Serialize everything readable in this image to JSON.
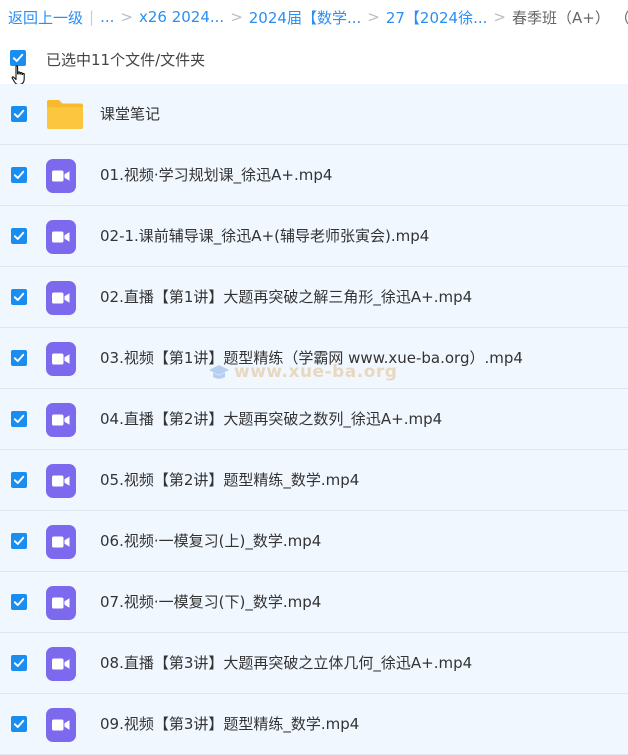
{
  "breadcrumb": {
    "back": "返回上一级",
    "divider": "|",
    "sep": ">",
    "items": [
      "...",
      "x26 2024...",
      "2024届【数学...",
      "27【2024徐..."
    ],
    "current": "春季班（A+）  （"
  },
  "selection": {
    "text": "已选中11个文件/文件夹"
  },
  "files": [
    {
      "type": "folder",
      "name": "课堂笔记"
    },
    {
      "type": "video",
      "name": "01.视频·学习规划课_徐迅A+.mp4"
    },
    {
      "type": "video",
      "name": "02-1.课前辅导课_徐迅A+(辅导老师张寅会).mp4"
    },
    {
      "type": "video",
      "name": "02.直播【第1讲】大题再突破之解三角形_徐迅A+.mp4"
    },
    {
      "type": "video",
      "name": "03.视频【第1讲】题型精练（学霸网 www.xue-ba.org）.mp4"
    },
    {
      "type": "video",
      "name": "04.直播【第2讲】大题再突破之数列_徐迅A+.mp4"
    },
    {
      "type": "video",
      "name": "05.视频【第2讲】题型精练_数学.mp4"
    },
    {
      "type": "video",
      "name": "06.视频·一模复习(上)_数学.mp4"
    },
    {
      "type": "video",
      "name": "07.视频·一模复习(下)_数学.mp4"
    },
    {
      "type": "video",
      "name": "08.直播【第3讲】大题再突破之立体几何_徐迅A+.mp4"
    },
    {
      "type": "video",
      "name": "09.视频【第3讲】题型精练_数学.mp4"
    }
  ],
  "watermark": "www.xue-ba.org",
  "colors": {
    "accent": "#2a8ff5",
    "checkbox": "#1a8df0",
    "row_bg": "#f1f7ff",
    "video_icon": "#7c69ee",
    "folder_icon": "#fcc63f"
  },
  "icons": [
    "checkbox-checked-icon",
    "folder-icon",
    "video-file-icon",
    "hand-cursor-icon"
  ]
}
